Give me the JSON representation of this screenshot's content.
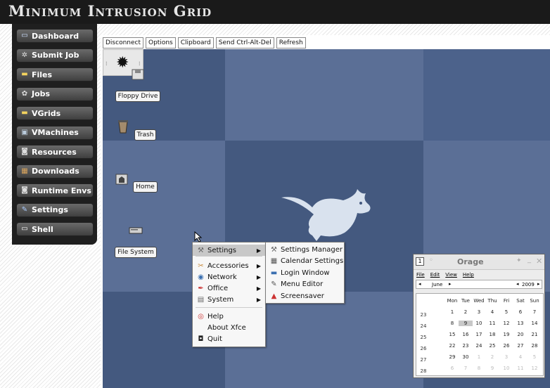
{
  "app": {
    "title": "Minimum Intrusion Grid"
  },
  "sidebar": {
    "items": [
      {
        "label": "Dashboard",
        "icon": "window-icon"
      },
      {
        "label": "Submit Job",
        "icon": "gears-icon"
      },
      {
        "label": "Files",
        "icon": "folder-icon"
      },
      {
        "label": "Jobs",
        "icon": "gear-icon"
      },
      {
        "label": "VGrids",
        "icon": "folder-icon"
      },
      {
        "label": "VMachines",
        "icon": "monitor-icon"
      },
      {
        "label": "Resources",
        "icon": "disk-icon"
      },
      {
        "label": "Downloads",
        "icon": "box-icon"
      },
      {
        "label": "Runtime Envs",
        "icon": "disk-icon"
      },
      {
        "label": "Settings",
        "icon": "wrench-icon"
      },
      {
        "label": "Shell",
        "icon": "terminal-icon"
      }
    ]
  },
  "toolbar": {
    "buttons": [
      "Disconnect",
      "Options",
      "Clipboard",
      "Send Ctrl-Alt-Del",
      "Refresh"
    ]
  },
  "desktop": {
    "icons": [
      "Floppy Drive",
      "Trash",
      "Home",
      "File System"
    ]
  },
  "context_menu": {
    "items": [
      {
        "label": "Settings",
        "submenu": true
      },
      {
        "label": "Accessories",
        "submenu": true
      },
      {
        "label": "Network",
        "submenu": true
      },
      {
        "label": "Office",
        "submenu": true
      },
      {
        "label": "System",
        "submenu": true
      },
      {
        "label": "Help",
        "submenu": false
      },
      {
        "label": "About Xfce",
        "submenu": false
      },
      {
        "label": "Quit",
        "submenu": false
      }
    ]
  },
  "settings_submenu": {
    "items": [
      "Settings Manager",
      "Calendar Settings",
      "Login Window",
      "Menu Editor",
      "Screensaver"
    ]
  },
  "orage": {
    "title": "Orage",
    "menu": [
      "File",
      "Edit",
      "View",
      "Help"
    ],
    "month": "June",
    "year": "2009",
    "weekdays": [
      "Mon",
      "Tue",
      "Wed",
      "Thu",
      "Fri",
      "Sat",
      "Sun"
    ],
    "weeks": [
      {
        "wk": "23",
        "days": [
          "1",
          "2",
          "3",
          "4",
          "5",
          "6",
          "7"
        ]
      },
      {
        "wk": "24",
        "days": [
          "8",
          "9",
          "10",
          "11",
          "12",
          "13",
          "14"
        ]
      },
      {
        "wk": "25",
        "days": [
          "15",
          "16",
          "17",
          "18",
          "19",
          "20",
          "21"
        ]
      },
      {
        "wk": "26",
        "days": [
          "22",
          "23",
          "24",
          "25",
          "26",
          "27",
          "28"
        ]
      },
      {
        "wk": "27",
        "days": [
          "29",
          "30",
          "1",
          "2",
          "3",
          "4",
          "5"
        ]
      },
      {
        "wk": "28",
        "days": [
          "6",
          "7",
          "8",
          "9",
          "10",
          "11",
          "12"
        ]
      }
    ],
    "today": "9"
  }
}
